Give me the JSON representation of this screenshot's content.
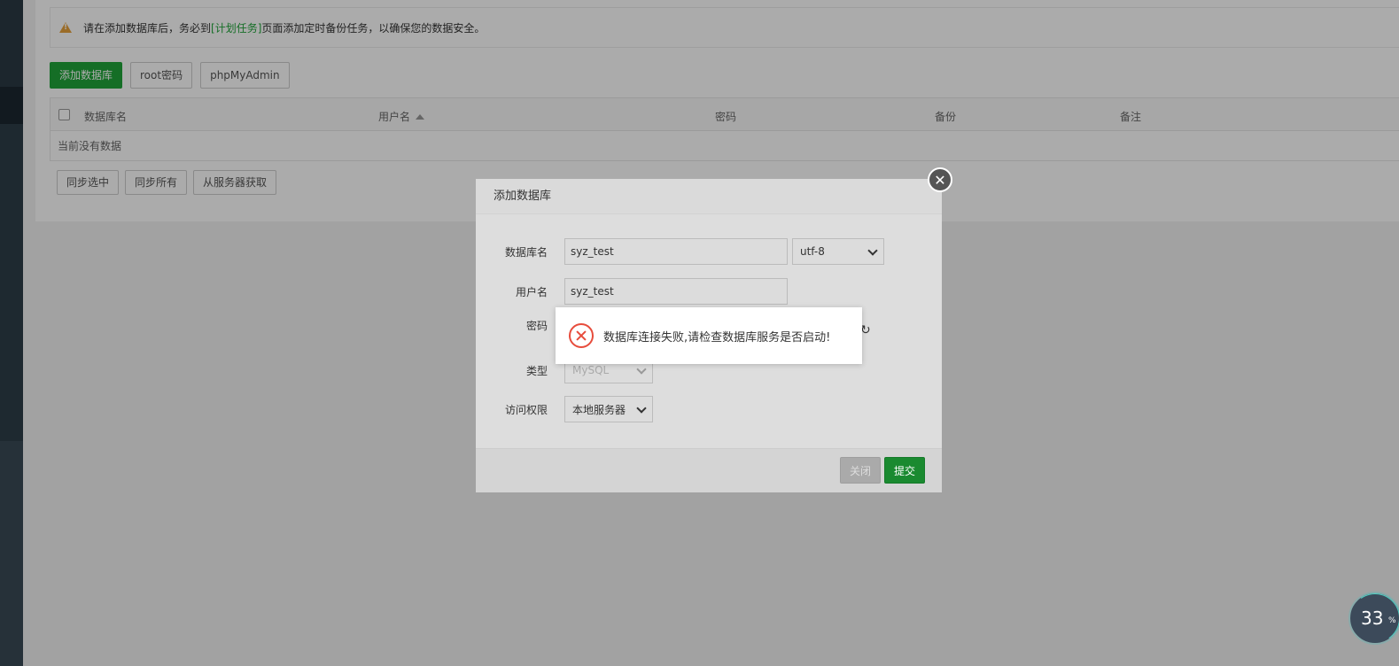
{
  "notice": {
    "text_before": "请在添加数据库后，务必到",
    "link": "[计划任务]",
    "text_after": "页面添加定时备份任务，以确保您的数据安全。"
  },
  "toolbar": {
    "add_db": "添加数据库",
    "root_password": "root密码",
    "phpmyadmin": "phpMyAdmin"
  },
  "table": {
    "columns": [
      "数据库名",
      "用户名",
      "密码",
      "备份",
      "备注"
    ],
    "empty_text": "当前没有数据"
  },
  "table_footer": {
    "sync_selected": "同步选中",
    "sync_all": "同步所有",
    "fetch_from_server": "从服务器获取"
  },
  "dialog": {
    "title": "添加数据库",
    "fields": {
      "db_name_label": "数据库名",
      "db_name_value": "syz_test",
      "charset_value": "utf-8",
      "username_label": "用户名",
      "username_value": "syz_test",
      "password_label_partial": "密码",
      "type_label": "类型",
      "type_value": "MySQL",
      "access_label": "访问权限",
      "access_value": "本地服务器"
    },
    "close_btn": "关闭",
    "submit_btn": "提交"
  },
  "message": {
    "text": "数据库连接失败,请检查数据库服务是否启动!"
  },
  "progress": {
    "value": "33",
    "unit": "%"
  },
  "colors": {
    "brand_green": "#20a53a",
    "error_red": "#e74c3c",
    "warning_orange": "#e6a23c"
  }
}
